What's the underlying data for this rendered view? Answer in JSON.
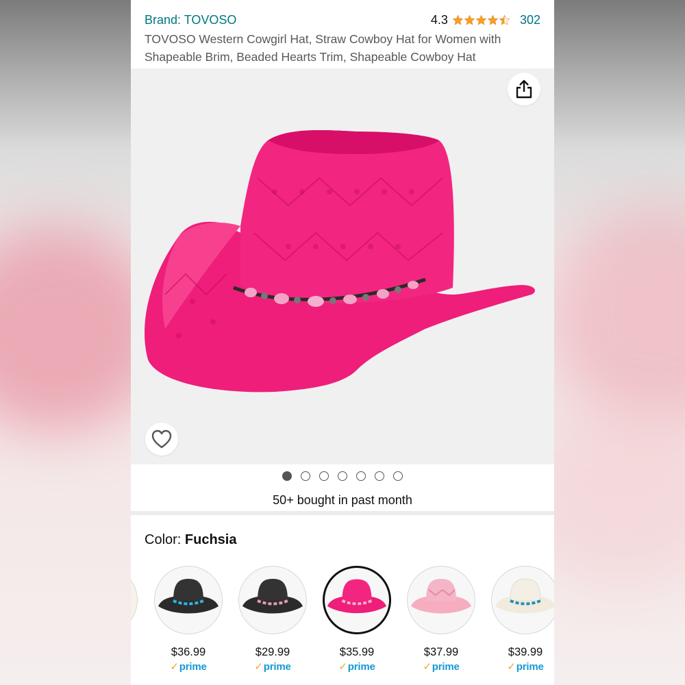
{
  "header": {
    "brand": "Brand: TOVOSO",
    "rating_value": "4.3",
    "review_count": "302",
    "title": "TOVOSO Western Cowgirl Hat, Straw Cowboy Hat for Women with Shapeable Brim, Beaded Hearts Trim, Shapeable Cowboy Hat",
    "star_color": "#f7a21b"
  },
  "gallery": {
    "image_count": 7,
    "active_index": 0,
    "share_icon": "share-icon",
    "wishlist_icon": "heart-icon",
    "hat_color": "#f0237a"
  },
  "social_proof": "50+ bought in past month",
  "color_selector": {
    "label": "Color: ",
    "selected": "Fuchsia",
    "options": [
      {
        "price": "$36.99",
        "prime": "prime",
        "hat_color": "#2b2b2b",
        "band_color": "#2fb4e6"
      },
      {
        "price": "$29.99",
        "prime": "prime",
        "hat_color": "#2b2b2b",
        "band_color": "#e79ab8"
      },
      {
        "price": "$35.99",
        "prime": "prime",
        "hat_color": "#f0237a",
        "band_color": "#f3b2cf",
        "selected": true
      },
      {
        "price": "$37.99",
        "prime": "prime",
        "hat_color": "#f6adc0",
        "band_color": "#f6adc0"
      },
      {
        "price": "$39.99",
        "prime": "prime",
        "hat_color": "#f3efe4",
        "band_color": "#1f8fb7"
      }
    ]
  }
}
